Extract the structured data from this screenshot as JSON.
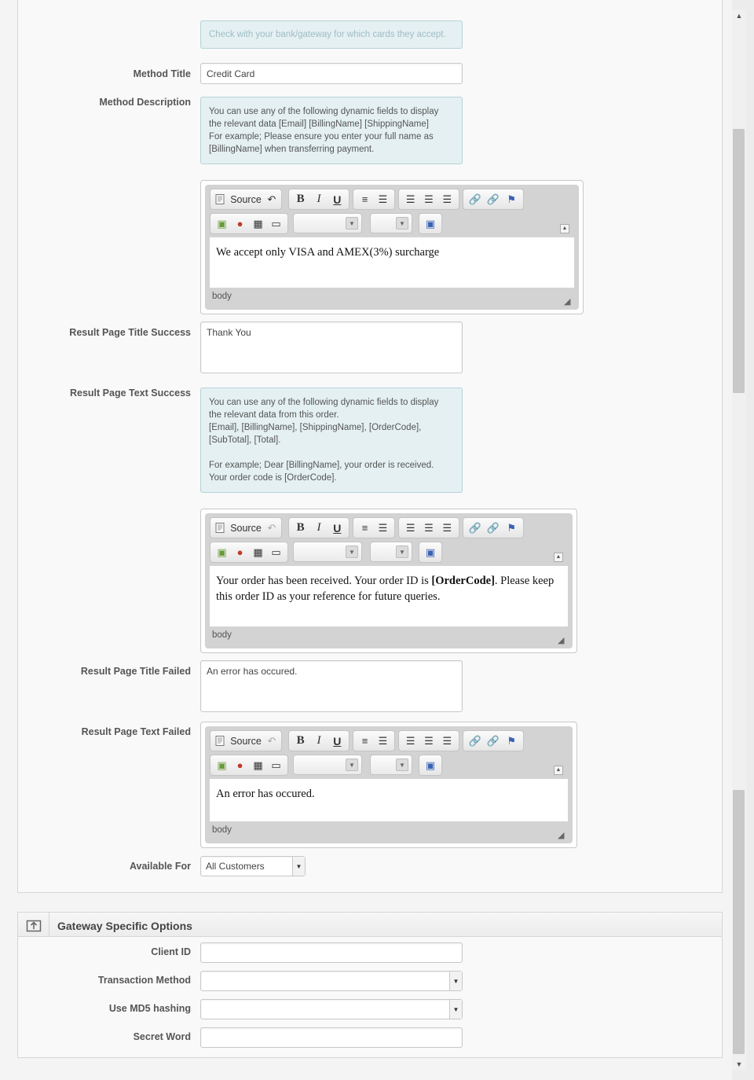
{
  "hint_top": "Check with your bank/gateway for which cards they accept.",
  "method_title": {
    "label": "Method Title",
    "value": "Credit Card"
  },
  "method_description": {
    "label": "Method Description",
    "hint": "You can use any of the following dynamic fields to display\nthe relevant data [Email] [BillingName] [ShippingName]\nFor example; Please ensure you enter your full name as\n[BillingName] when transferring payment."
  },
  "editor_common": {
    "source_label": "Source",
    "footer_path": "body"
  },
  "editor_1_content": "We accept only VISA and AMEX(3%) surcharge",
  "result_title_success": {
    "label": "Result Page Title Success",
    "value": "Thank You"
  },
  "result_text_success": {
    "label": "Result Page Text Success",
    "hint": "You can use any of the following dynamic fields to display\nthe relevant data from this order.\n[Email], [BillingName], [ShippingName], [OrderCode],\n[SubTotal], [Total].\n\nFor example; Dear [BillingName], your order is received.\nYour order code is [OrderCode].",
    "content_before": "Your order has been received. Your order ID is ",
    "content_bold": "[OrderCode]",
    "content_after": ". Please keep this order ID as your reference for future queries."
  },
  "result_title_failed": {
    "label": "Result Page Title Failed",
    "value": "An error has occured."
  },
  "result_text_failed": {
    "label": "Result Page Text Failed",
    "content": "An error has occured."
  },
  "available_for": {
    "label": "Available For",
    "value": "All Customers"
  },
  "gateway": {
    "title": "Gateway Specific Options",
    "client_id": {
      "label": "Client ID",
      "value": ""
    },
    "transaction_method": {
      "label": "Transaction Method",
      "value": ""
    },
    "use_md5": {
      "label": "Use MD5 hashing",
      "value": ""
    },
    "secret_word": {
      "label": "Secret Word",
      "value": ""
    }
  }
}
